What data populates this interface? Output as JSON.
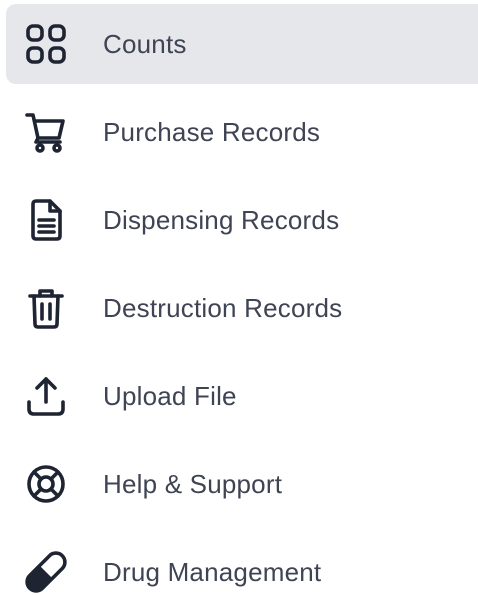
{
  "sidebar": {
    "items": [
      {
        "label": "Counts",
        "icon": "grid-icon",
        "active": true
      },
      {
        "label": "Purchase Records",
        "icon": "cart-icon",
        "active": false
      },
      {
        "label": "Dispensing Records",
        "icon": "document-icon",
        "active": false
      },
      {
        "label": "Destruction Records",
        "icon": "trash-icon",
        "active": false
      },
      {
        "label": "Upload File",
        "icon": "upload-icon",
        "active": false
      },
      {
        "label": "Help & Support",
        "icon": "lifebuoy-icon",
        "active": false
      },
      {
        "label": "Drug Management",
        "icon": "pill-icon",
        "active": false
      }
    ]
  },
  "colors": {
    "active_bg": "#e5e7eb",
    "icon": "#1f2433",
    "text": "#3f4454"
  }
}
